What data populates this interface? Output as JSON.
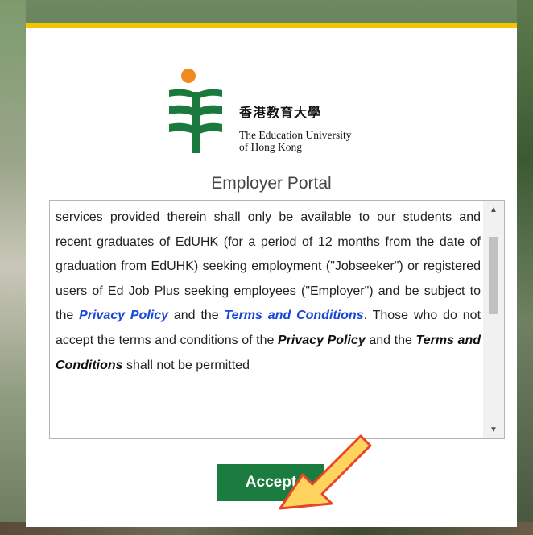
{
  "logo": {
    "name_zh": "香港教育大學",
    "name_en_line1": "The Education University",
    "name_en_line2": "of Hong Kong",
    "colors": {
      "green": "#1a7a3e",
      "orange": "#f08a1c"
    }
  },
  "portal": {
    "title": "Employer Portal"
  },
  "terms": {
    "seg1": "services provided therein shall only be available to our students and recent graduates of EdUHK (for a period of 12 months from the date of graduation from EdUHK) seeking employment (\"Jobseeker\") or registered users of Ed Job Plus seeking employees (\"Employer\") and be subject to the ",
    "privacy_link": "Privacy Policy",
    "seg2": " and the ",
    "terms_link": "Terms and Conditions",
    "seg3": ". Those who do not accept the terms and conditions of the ",
    "privacy_em": "Privacy Policy",
    "seg4": " and the ",
    "terms_em": "Terms and Conditions",
    "seg5": " shall not be permitted"
  },
  "actions": {
    "accept_label": "Accept"
  },
  "colors": {
    "accent_bar": "#f5c400",
    "button": "#1a7c3e",
    "link": "#1846d8",
    "arrow_fill": "#ffd45e",
    "arrow_stroke": "#e8452a"
  },
  "icons": {
    "scroll_up": "triangle-up-icon",
    "scroll_down": "triangle-down-icon",
    "pointer": "arrow-pointer-icon"
  }
}
